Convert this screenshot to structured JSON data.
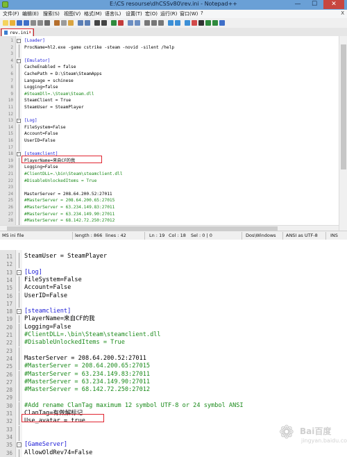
{
  "window": {
    "title": "E:\\CS resourse\\dhCSSv80\\rev.ini - Notepad++",
    "buttons": {
      "minimize": "—",
      "maximize": "☐",
      "close": "✕"
    }
  },
  "menu": [
    "文件(F)",
    "编辑(E)",
    "搜索(S)",
    "视图(V)",
    "格式(M)",
    "语言(L)",
    "设置(T)",
    "宏(O)",
    "运行(R)",
    "窗口(W)",
    "?"
  ],
  "menu_close": "X",
  "tab": {
    "label": "rev.ini",
    "close": "x"
  },
  "editor1": {
    "lines": [
      {
        "n": "1",
        "t": "[Loader]",
        "c": "sect",
        "fold": "-"
      },
      {
        "n": "2",
        "t": "ProcName=hl2.exe -game cstrike -steam -novid -silent /help"
      },
      {
        "n": "3",
        "t": ""
      },
      {
        "n": "4",
        "t": "[Emulator]",
        "c": "sect",
        "fold": "-"
      },
      {
        "n": "5",
        "t": "CacheEnabled = false"
      },
      {
        "n": "6",
        "t": "CachePath = D:\\Steam\\SteamApps"
      },
      {
        "n": "7",
        "t": "Language = schinese"
      },
      {
        "n": "8",
        "t": "Logging=false"
      },
      {
        "n": "9",
        "t": "#SteamDll=.\\Steam\\Steam.dll",
        "c": "cmt"
      },
      {
        "n": "10",
        "t": "SteamClient = True"
      },
      {
        "n": "11",
        "t": "SteamUser = SteamPlayer"
      },
      {
        "n": "12",
        "t": ""
      },
      {
        "n": "13",
        "t": "[Log]",
        "c": "sect",
        "fold": "-"
      },
      {
        "n": "14",
        "t": "FileSystem=False"
      },
      {
        "n": "15",
        "t": "Account=False"
      },
      {
        "n": "16",
        "t": "UserID=False"
      },
      {
        "n": "17",
        "t": ""
      },
      {
        "n": "18",
        "t": "[steamclient]",
        "c": "sect",
        "fold": "-"
      },
      {
        "n": "19",
        "t": "PlayerName=来自CF的我"
      },
      {
        "n": "20",
        "t": "Logging=False"
      },
      {
        "n": "21",
        "t": "#ClientDLL=.\\bin\\Steam\\steamclient.dll",
        "c": "cmt"
      },
      {
        "n": "22",
        "t": "#DisableUnlockedItems = True",
        "c": "cmt"
      },
      {
        "n": "23",
        "t": ""
      },
      {
        "n": "24",
        "t": "MasterServer = 208.64.200.52:27011"
      },
      {
        "n": "25",
        "t": "#MasterServer = 208.64.200.65:27015",
        "c": "cmt"
      },
      {
        "n": "26",
        "t": "#MasterServer = 63.234.149.83:27011",
        "c": "cmt"
      },
      {
        "n": "27",
        "t": "#MasterServer = 63.234.149.90:27011",
        "c": "cmt"
      },
      {
        "n": "28",
        "t": "#MasterServer = 68.142.72.250:27012",
        "c": "cmt"
      },
      {
        "n": "29",
        "t": ""
      }
    ]
  },
  "status": {
    "filetype": "MS ini file",
    "length": "length : 866",
    "lines": "lines : 42",
    "ln": "Ln : 19",
    "col": "Col : 18",
    "sel": "Sel : 0 | 0",
    "eol": "Dos\\Windows",
    "encoding": "ANSI as UTF-8",
    "mode": "INS"
  },
  "editor2": {
    "lines": [
      {
        "n": "11",
        "t": "SteamUser = SteamPlayer"
      },
      {
        "n": "12",
        "t": ""
      },
      {
        "n": "13",
        "t": "[Log]",
        "c": "sect",
        "fold": "-"
      },
      {
        "n": "14",
        "t": "FileSystem=False"
      },
      {
        "n": "15",
        "t": "Account=False"
      },
      {
        "n": "16",
        "t": "UserID=False"
      },
      {
        "n": "17",
        "t": ""
      },
      {
        "n": "18",
        "t": "[steamclient]",
        "c": "sect",
        "fold": "-"
      },
      {
        "n": "19",
        "t": "PlayerName=来自CF的我"
      },
      {
        "n": "20",
        "t": "Logging=False"
      },
      {
        "n": "21",
        "t": "#ClientDLL=.\\bin\\Steam\\steamclient.dll",
        "c": "cmt"
      },
      {
        "n": "22",
        "t": "#DisableUnlockedItems = True",
        "c": "cmt"
      },
      {
        "n": "23",
        "t": ""
      },
      {
        "n": "24",
        "t": "MasterServer = 208.64.200.52:27011"
      },
      {
        "n": "25",
        "t": "#MasterServer = 208.64.200.65:27015",
        "c": "cmt"
      },
      {
        "n": "26",
        "t": "#MasterServer = 63.234.149.83:27011",
        "c": "cmt"
      },
      {
        "n": "27",
        "t": "#MasterServer = 63.234.149.90:27011",
        "c": "cmt"
      },
      {
        "n": "28",
        "t": "#MasterServer = 68.142.72.250:27012",
        "c": "cmt"
      },
      {
        "n": "29",
        "t": ""
      },
      {
        "n": "30",
        "t": "#Add rename ClanTag maximum 12 symbol UTF-8 or 24 symbol ANSI",
        "c": "cmt"
      },
      {
        "n": "31",
        "t": "ClanTag=有做解标记"
      },
      {
        "n": "32",
        "t": "Use_avatar = true"
      },
      {
        "n": "33",
        "t": ""
      },
      {
        "n": "34",
        "t": ""
      },
      {
        "n": "35",
        "t": "[GameServer]",
        "c": "sect",
        "fold": "-"
      },
      {
        "n": "36",
        "t": "AllowOldRev74=False"
      }
    ]
  },
  "watermark": {
    "brand": "Bai百度",
    "sub": "jingyan.baidu.com"
  },
  "colors": {
    "section": "#1b1bd6",
    "comment": "#1a8a1a",
    "highlight": "#e0242f",
    "titlebar": "#6aa0d6"
  }
}
